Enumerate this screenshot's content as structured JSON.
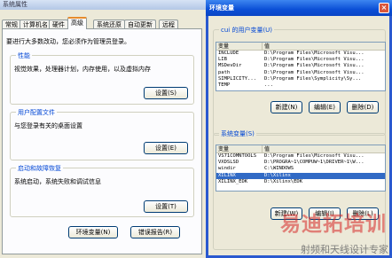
{
  "system_properties": {
    "title": "系统属性",
    "tabs": [
      {
        "label": "常规"
      },
      {
        "label": "计算机名"
      },
      {
        "label": "硬件"
      },
      {
        "label": "高级",
        "active": true
      },
      {
        "label": "系统还原"
      },
      {
        "label": "自动更新"
      },
      {
        "label": "远程"
      }
    ],
    "admin_note": "要进行大多数改动，您必须作为管理员登录。",
    "performance": {
      "title": "性能",
      "desc": "视觉效果，处理器计划，内存使用，以及虚拟内存",
      "button": "设置(S)"
    },
    "user_profiles": {
      "title": "用户配置文件",
      "desc": "与您登录有关的桌面设置",
      "button": "设置(E)"
    },
    "startup_recovery": {
      "title": "启动和故障恢复",
      "desc": "系统启动，系统失败和调试信息",
      "button": "设置(T)"
    },
    "env_button": "环境变量(N)",
    "error_report_button": "错误报告(R)"
  },
  "env_vars": {
    "title": "环境变量",
    "close_glyph": "×",
    "user_group_title": "cui 的用户变量(U)",
    "col_variable": "变量",
    "col_value": "值",
    "user_vars": [
      {
        "name": "INCLUDE",
        "value": "D:\\Program Files\\Microsoft Visu..."
      },
      {
        "name": "LIB",
        "value": "D:\\Program Files\\Microsoft Visu..."
      },
      {
        "name": "MSDevDir",
        "value": "D:\\Program Files\\Microsoft Visu..."
      },
      {
        "name": "path",
        "value": "D:\\Program Files\\Microsoft Visu..."
      },
      {
        "name": "SIMPLICITY...",
        "value": "D:\\Program Files\\Symplicity\\Sy..."
      },
      {
        "name": "TEMP",
        "value": "..."
      }
    ],
    "user_buttons": {
      "new": "新建(N)",
      "edit": "编辑(E)",
      "delete": "删除(D)"
    },
    "system_group_title": "系统变量(S)",
    "system_vars": [
      {
        "name": "VS71COMNTOOLS",
        "value": "D:\\Program Files\\Microsoft Visu..."
      },
      {
        "name": "VXDSLSD",
        "value": "D:\\PROGRA~1\\COMPUW~1\\DRIVER~1\\W..."
      },
      {
        "name": "windir",
        "value": "C:\\WINDOWS"
      },
      {
        "name": "XILINX",
        "value": "D:\\Xilinx",
        "selected": true
      },
      {
        "name": "XILINX_EDK",
        "value": "D:\\Xilinx\\EDK"
      }
    ],
    "system_buttons": {
      "new": "新建(W)",
      "edit": "编辑(I)",
      "delete": "删除(L)"
    }
  },
  "watermark": {
    "main": "易迪拓培训",
    "sub": "射频和天线设计专家"
  }
}
